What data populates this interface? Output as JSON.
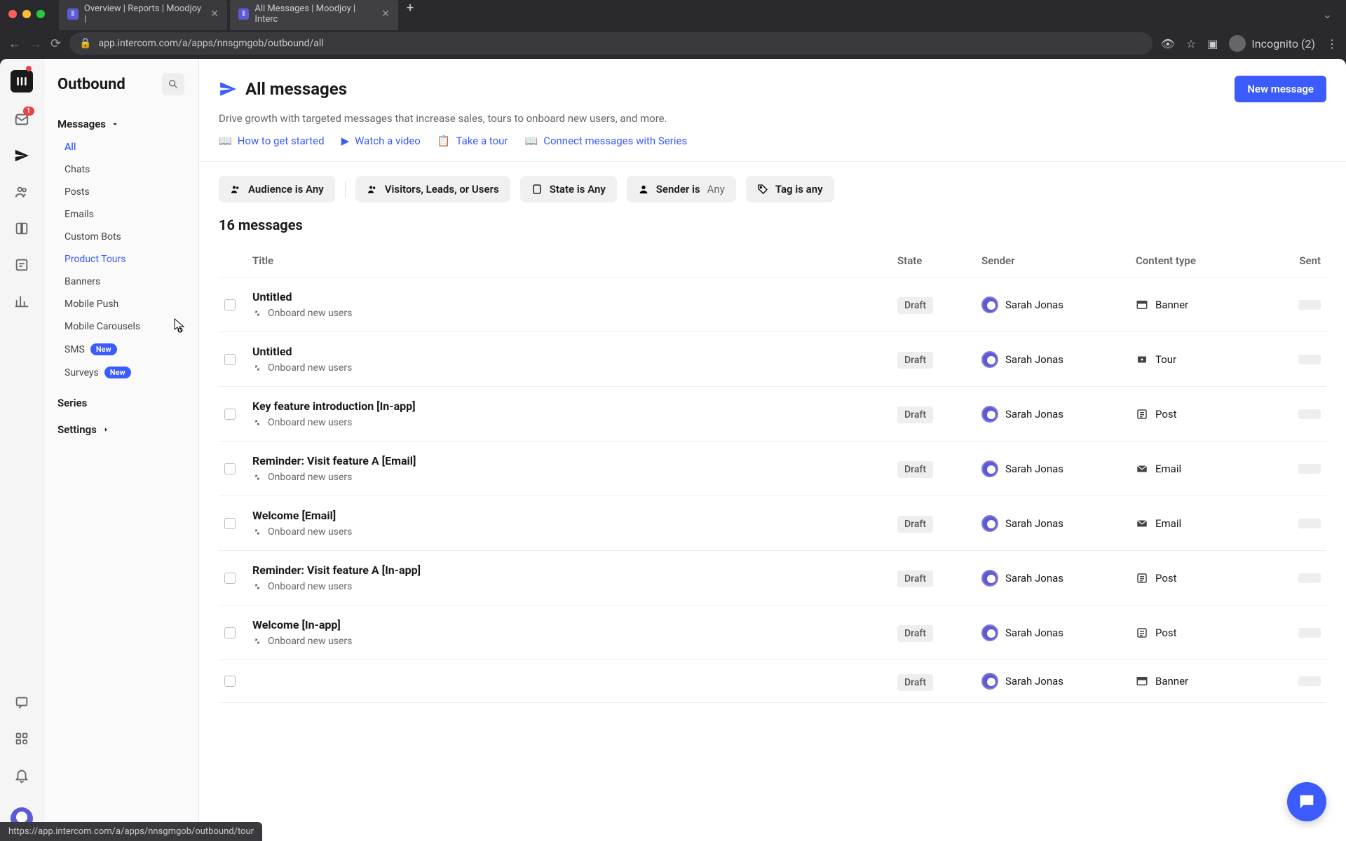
{
  "browser": {
    "tabs": [
      {
        "title": "Overview | Reports | Moodjoy |",
        "active": false
      },
      {
        "title": "All Messages | Moodjoy | Interc",
        "active": true
      }
    ],
    "url": "app.intercom.com/a/apps/nnsgmgob/outbound/all",
    "incognito_label": "Incognito (2)"
  },
  "rail": {
    "inbox_badge": "1"
  },
  "sidebar": {
    "title": "Outbound",
    "section_messages": "Messages",
    "items": [
      {
        "label": "All",
        "active": true
      },
      {
        "label": "Chats"
      },
      {
        "label": "Posts"
      },
      {
        "label": "Emails"
      },
      {
        "label": "Custom Bots"
      },
      {
        "label": "Product Tours",
        "highlight": true
      },
      {
        "label": "Banners"
      },
      {
        "label": "Mobile Push"
      },
      {
        "label": "Mobile Carousels"
      },
      {
        "label": "SMS",
        "badge": "New"
      },
      {
        "label": "Surveys",
        "badge": "New"
      }
    ],
    "series_label": "Series",
    "settings_label": "Settings"
  },
  "header": {
    "title": "All messages",
    "subtitle": "Drive growth with targeted messages that increase sales, tours to onboard new users, and more.",
    "help_links": [
      "How to get started",
      "Watch a video",
      "Take a tour",
      "Connect messages with Series"
    ],
    "new_message_btn": "New message"
  },
  "filters": [
    {
      "icon": "people",
      "label": "Audience is",
      "value": "Any",
      "bold_value": true
    },
    {
      "icon": "people",
      "label": "Visitors, Leads, or Users",
      "value": "",
      "bold_value": false
    },
    {
      "icon": "doc",
      "label": "State is",
      "value": "Any",
      "bold_value": true
    },
    {
      "icon": "person",
      "label": "Sender is",
      "value": "Any",
      "bold_value": false
    },
    {
      "icon": "tag",
      "label": "Tag is",
      "value": "any",
      "bold_value": true
    }
  ],
  "count": "16 messages",
  "columns": [
    "Title",
    "State",
    "Sender",
    "Content type",
    "Sent"
  ],
  "rows": [
    {
      "title": "Untitled",
      "sub": "Onboard new users",
      "state": "Draft",
      "sender": "Sarah Jonas",
      "content_type": "Banner"
    },
    {
      "title": "Untitled",
      "sub": "Onboard new users",
      "state": "Draft",
      "sender": "Sarah Jonas",
      "content_type": "Tour"
    },
    {
      "title": "Key feature introduction [In-app]",
      "sub": "Onboard new users",
      "state": "Draft",
      "sender": "Sarah Jonas",
      "content_type": "Post"
    },
    {
      "title": "Reminder: Visit feature A [Email]",
      "sub": "Onboard new users",
      "state": "Draft",
      "sender": "Sarah Jonas",
      "content_type": "Email"
    },
    {
      "title": "Welcome [Email]",
      "sub": "Onboard new users",
      "state": "Draft",
      "sender": "Sarah Jonas",
      "content_type": "Email"
    },
    {
      "title": "Reminder: Visit feature A [In-app]",
      "sub": "Onboard new users",
      "state": "Draft",
      "sender": "Sarah Jonas",
      "content_type": "Post"
    },
    {
      "title": "Welcome [In-app]",
      "sub": "Onboard new users",
      "state": "Draft",
      "sender": "Sarah Jonas",
      "content_type": "Post"
    },
    {
      "title": "",
      "sub": "",
      "state": "Draft",
      "sender": "Sarah Jonas",
      "content_type": "Banner"
    }
  ],
  "status_bar": "https://app.intercom.com/a/apps/nnsgmgob/outbound/tour"
}
